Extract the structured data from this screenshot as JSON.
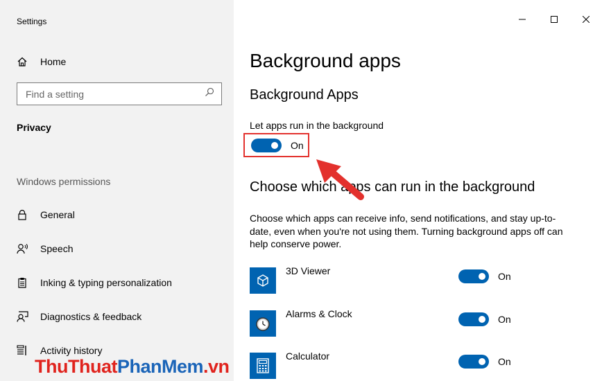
{
  "window": {
    "title": "Settings",
    "controls": {
      "minimize": "minimize-icon",
      "maximize": "maximize-icon",
      "close": "close-icon"
    }
  },
  "sidebar": {
    "home_label": "Home",
    "search_placeholder": "Find a setting",
    "current_section": "Privacy",
    "group_label": "Windows permissions",
    "items": [
      {
        "label": "General",
        "icon": "lock-icon"
      },
      {
        "label": "Speech",
        "icon": "speech-icon"
      },
      {
        "label": "Inking & typing personalization",
        "icon": "clipboard-icon"
      },
      {
        "label": "Diagnostics & feedback",
        "icon": "feedback-icon"
      },
      {
        "label": "Activity history",
        "icon": "activity-history-icon"
      }
    ]
  },
  "main": {
    "page_title": "Background apps",
    "section_title": "Background Apps",
    "toggle_label": "Let apps run in the background",
    "toggle_state": "On",
    "choose_title": "Choose which apps can run in the background",
    "description": "Choose which apps can receive info, send notifications, and stay up-to-date, even when you're not using them. Turning background apps off can help conserve power.",
    "apps": [
      {
        "name": "3D Viewer",
        "state": "On",
        "icon": "cube-icon"
      },
      {
        "name": "Alarms & Clock",
        "state": "On",
        "icon": "clock-icon"
      },
      {
        "name": "Calculator",
        "state": "On",
        "icon": "calculator-icon"
      }
    ]
  },
  "watermark": {
    "part1": "ThuThuat",
    "part2": "PhanMem",
    "part3": ".vn"
  },
  "colors": {
    "accent": "#0063b1",
    "highlight": "#e3312d",
    "sidebar_bg": "#f2f2f2"
  }
}
